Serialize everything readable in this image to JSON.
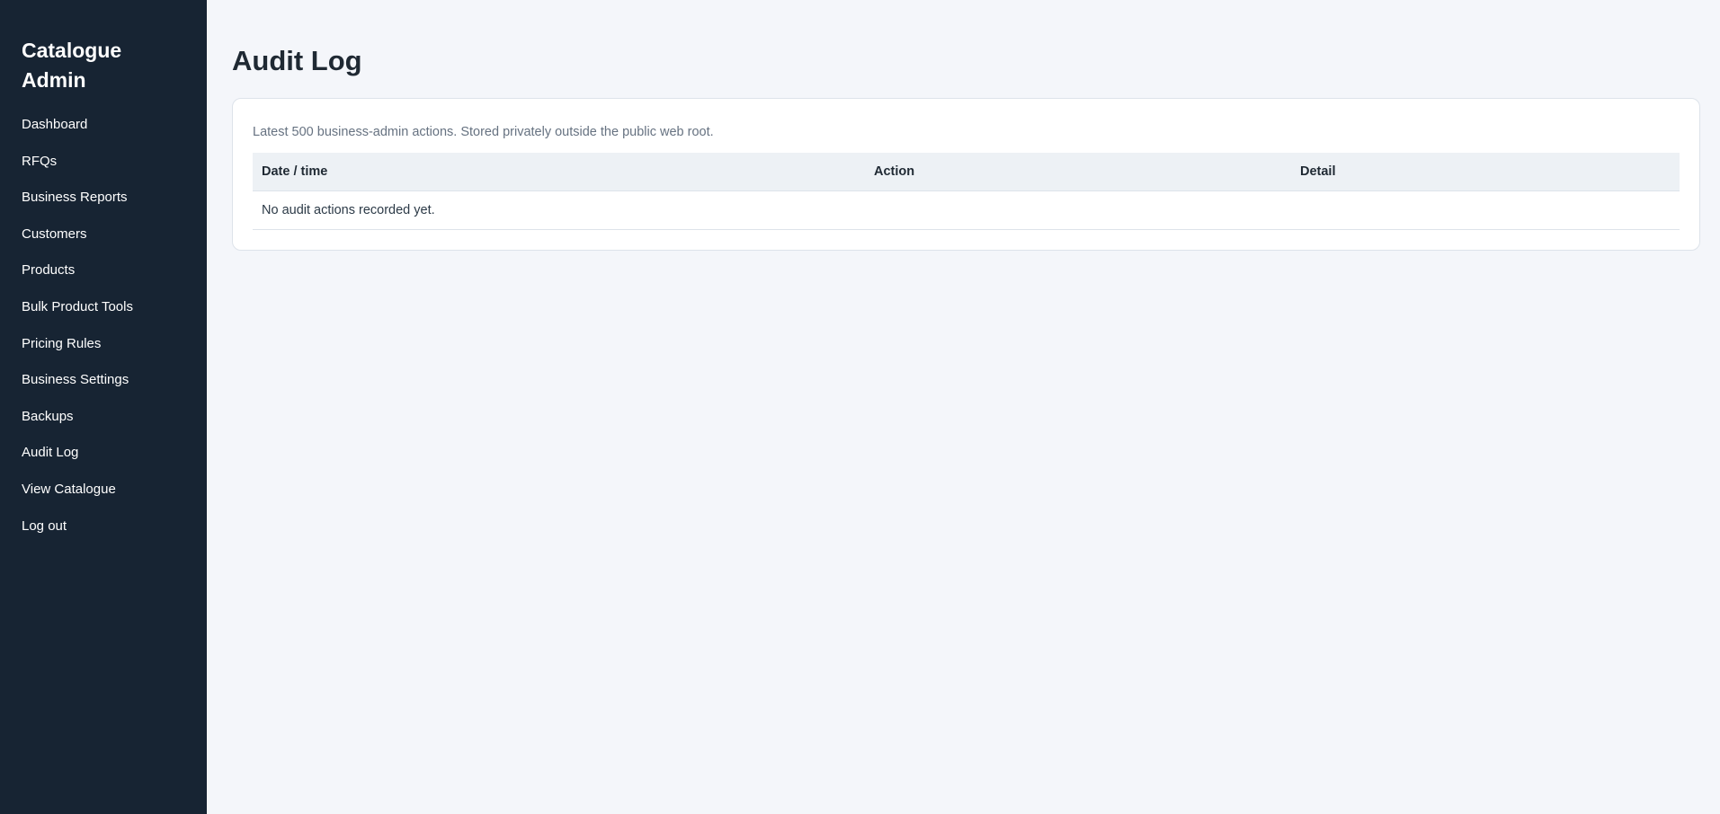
{
  "sidebar": {
    "brand": "Catalogue Admin",
    "items": [
      {
        "label": "Dashboard"
      },
      {
        "label": "RFQs"
      },
      {
        "label": "Business Reports"
      },
      {
        "label": "Customers"
      },
      {
        "label": "Products"
      },
      {
        "label": "Bulk Product Tools"
      },
      {
        "label": "Pricing Rules"
      },
      {
        "label": "Business Settings"
      },
      {
        "label": "Backups"
      },
      {
        "label": "Audit Log"
      },
      {
        "label": "View Catalogue"
      },
      {
        "label": "Log out"
      }
    ]
  },
  "main": {
    "title": "Audit Log",
    "description": "Latest 500 business-admin actions. Stored privately outside the public web root.",
    "table": {
      "columns": [
        "Date / time",
        "Action",
        "Detail"
      ],
      "empty_message": "No audit actions recorded yet."
    }
  },
  "colors": {
    "sidebar_bg": "#172433",
    "page_bg": "#f4f6fa",
    "table_header_bg": "#edf1f5"
  }
}
